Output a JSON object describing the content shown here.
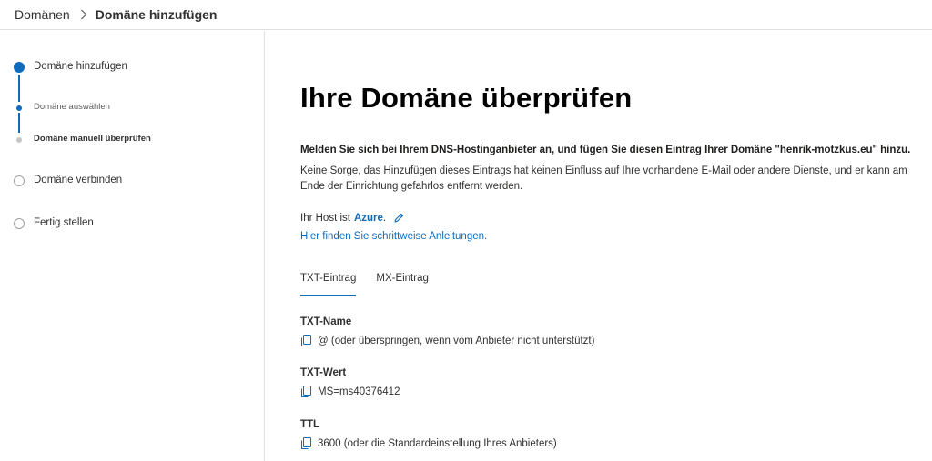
{
  "breadcrumb": {
    "parent": "Domänen",
    "current": "Domäne hinzufügen"
  },
  "sidebar": {
    "steps": [
      {
        "label": "Domäne hinzufügen",
        "state": "active"
      },
      {
        "label": "Domäne auswählen",
        "state": "done"
      },
      {
        "label": "Domäne manuell überprüfen",
        "state": "current"
      },
      {
        "label": "Domäne verbinden",
        "state": "pending"
      },
      {
        "label": "Fertig stellen",
        "state": "pending"
      }
    ]
  },
  "main": {
    "title": "Ihre Domäne überprüfen",
    "lead": "Melden Sie sich bei Ihrem DNS-Hostinganbieter an, und fügen Sie diesen Eintrag Ihrer Domäne \"henrik-motzkus.eu\" hinzu.",
    "description": "Keine Sorge, das Hinzufügen dieses Eintrags hat keinen Einfluss auf Ihre vorhandene E-Mail oder andere Dienste, und er kann am Ende der Einrichtung gefahrlos entfernt werden.",
    "host_prefix": "Ihr Host ist",
    "host_name": "Azure",
    "host_suffix": ".",
    "guide_link": "Hier finden Sie schrittweise Anleitungen.",
    "tabs": [
      {
        "label": "TXT-Eintrag",
        "active": true
      },
      {
        "label": "MX-Eintrag",
        "active": false
      }
    ],
    "fields": [
      {
        "label": "TXT-Name",
        "value": "@ (oder überspringen, wenn vom Anbieter nicht unterstützt)"
      },
      {
        "label": "TXT-Wert",
        "value": "MS=ms40376412"
      },
      {
        "label": "TTL",
        "value": "3600 (oder die Standardeinstellung Ihres Anbieters)"
      }
    ]
  },
  "colors": {
    "accent": "#0f6cbd",
    "text": "#323130",
    "border": "#e1dfdd"
  },
  "icons": [
    "chevron-right-icon",
    "pencil-icon",
    "copy-icon"
  ]
}
